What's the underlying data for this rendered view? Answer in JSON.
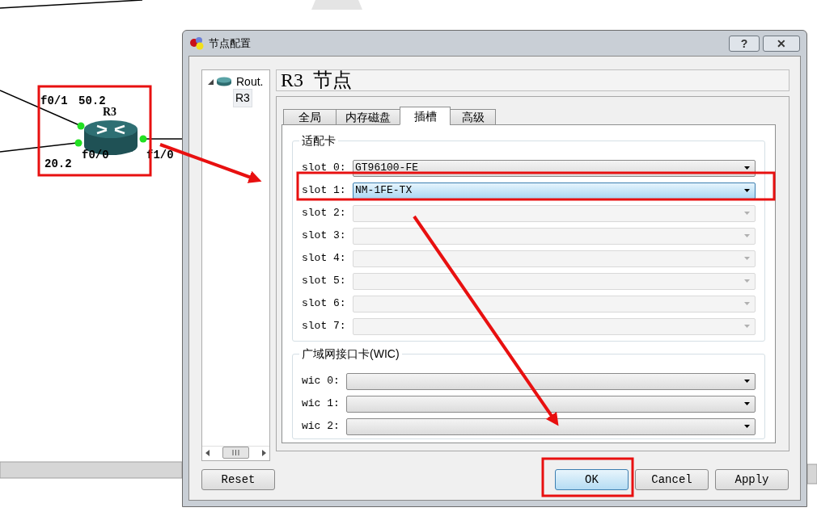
{
  "canvas": {
    "node": {
      "name": "R3",
      "labels": [
        {
          "kind": "port",
          "text": "f0/1"
        },
        {
          "kind": "address",
          "text": "50.2"
        },
        {
          "kind": "port",
          "text": "f0/0"
        },
        {
          "kind": "address",
          "text": "20.2"
        },
        {
          "kind": "port",
          "text": "f1/0"
        }
      ]
    }
  },
  "dialog": {
    "title": "节点配置",
    "help_button": "?",
    "close_button": "✕",
    "tree": [
      {
        "label": "Rout.",
        "expanded": true,
        "children": [
          {
            "label": "R3",
            "selected": true
          }
        ]
      }
    ],
    "header": "R3  节点",
    "tabs": [
      {
        "label": "全局",
        "selected": false
      },
      {
        "label": "内存磁盘",
        "selected": false
      },
      {
        "label": "插槽",
        "selected": true
      },
      {
        "label": "高级",
        "selected": false
      }
    ],
    "adapters": {
      "title": "适配卡",
      "slots": [
        {
          "label": "slot 0:",
          "value": "GT96100-FE",
          "disabled": false,
          "focused": false
        },
        {
          "label": "slot 1:",
          "value": "NM-1FE-TX",
          "disabled": false,
          "focused": true
        },
        {
          "label": "slot 2:",
          "disabled": true,
          "focused": false
        },
        {
          "label": "slot 3:",
          "disabled": true,
          "focused": false
        },
        {
          "label": "slot 4:",
          "disabled": true,
          "focused": false
        },
        {
          "label": "slot 5:",
          "disabled": true,
          "focused": false
        },
        {
          "label": "slot 6:",
          "disabled": true,
          "focused": false
        },
        {
          "label": "slot 7:",
          "disabled": true,
          "focused": false
        }
      ]
    },
    "wic": {
      "title": "广域网接口卡(WIC)",
      "slots": [
        {
          "label": "wic 0:",
          "disabled": false,
          "focused": false
        },
        {
          "label": "wic 1:",
          "disabled": false,
          "focused": false
        },
        {
          "label": "wic 2:",
          "disabled": false,
          "focused": false
        }
      ]
    },
    "buttons": [
      {
        "label": "Reset",
        "focused": false
      },
      {
        "label": "OK",
        "focused": true
      },
      {
        "label": "Cancel",
        "focused": false
      },
      {
        "label": "Apply",
        "focused": false
      }
    ]
  }
}
